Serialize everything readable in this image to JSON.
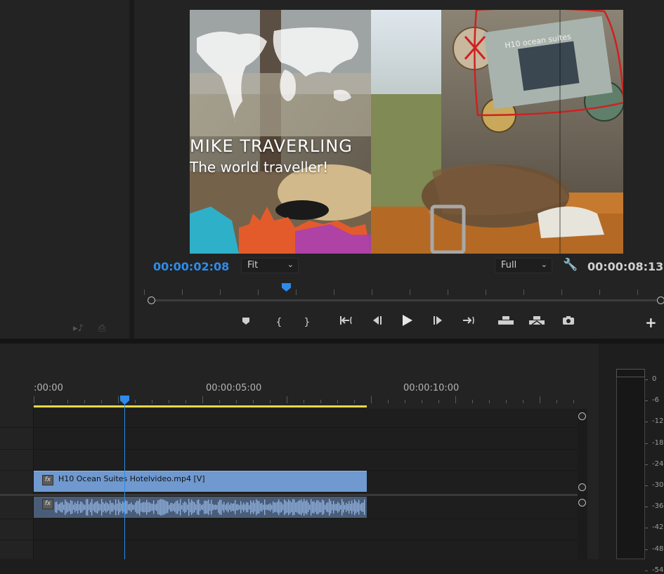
{
  "project_panel": {
    "icons": [
      "music-note-insert-icon",
      "export-frame-icon"
    ]
  },
  "program_monitor": {
    "video_title": "MIKE TRAVERLING",
    "video_subtitle": "The world traveller!",
    "hotel_sign_text": "H10 ocean suites",
    "current_timecode": "00:00:02:08",
    "duration_timecode": "00:00:08:13",
    "zoom_level": "Fit",
    "playback_resolution": "Full",
    "playhead_fraction": 0.28,
    "transport_controls": [
      {
        "name": "add-marker",
        "glyph": "⬟"
      },
      {
        "name": "mark-in",
        "glyph": "{"
      },
      {
        "name": "mark-out",
        "glyph": "}"
      },
      {
        "name": "go-to-in",
        "glyph": "|←"
      },
      {
        "name": "step-back",
        "glyph": "◀|"
      },
      {
        "name": "play",
        "glyph": "▶"
      },
      {
        "name": "step-forward",
        "glyph": "|▶"
      },
      {
        "name": "go-to-out",
        "glyph": "→|"
      },
      {
        "name": "lift",
        "glyph": "⏏"
      },
      {
        "name": "extract",
        "glyph": "⏏"
      },
      {
        "name": "export-frame",
        "glyph": "📷"
      }
    ],
    "add_button": "+"
  },
  "timeline": {
    "time_labels": [
      ":00:00",
      "00:00:05:00",
      "00:00:10:00"
    ],
    "playhead_time": "00:00:02:08",
    "video_clip": {
      "label": "H10 Ocean Suites Hotelvideo.mp4 [V]",
      "fx_badge": "fx",
      "color": "#6f99cf"
    },
    "audio_clip": {
      "fx_badge": "fx",
      "color": "#4a5d78"
    }
  },
  "audio_meter": {
    "scale": [
      "0",
      "-6",
      "-12",
      "-18",
      "-24",
      "-30",
      "-36",
      "-42",
      "-48",
      "-54"
    ]
  },
  "colors": {
    "accent": "#2d8ceb",
    "work_area": "#e8d74a",
    "annotation": "#d02020"
  }
}
